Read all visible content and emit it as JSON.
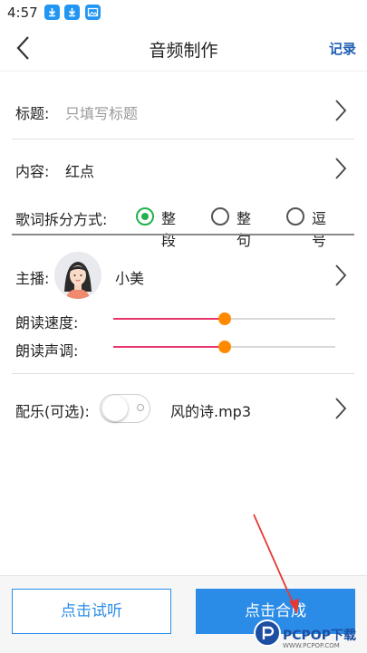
{
  "status_bar": {
    "time": "4:57"
  },
  "nav": {
    "title": "音频制作",
    "right_label": "记录"
  },
  "title_row": {
    "label": "标题:",
    "placeholder": "只填写标题"
  },
  "content_row": {
    "label": "内容:",
    "value": "红点"
  },
  "lyrics_split": {
    "label": "歌词拆分方式:",
    "options": [
      {
        "label": "整段",
        "selected": true
      },
      {
        "label": "整句",
        "selected": false
      },
      {
        "label": "逗号",
        "selected": false
      }
    ]
  },
  "anchor": {
    "label": "主播:",
    "name": "小美"
  },
  "reading_speed": {
    "label": "朗读速度:",
    "level": 0.5
  },
  "reading_pitch": {
    "label": "朗读声调:",
    "level": 0.5
  },
  "music": {
    "label": "配乐(可选):",
    "enabled": false,
    "file": "风的诗.mp3"
  },
  "actions": {
    "listen_label": "点击试听",
    "compose_label": "点击合成"
  },
  "watermark": {
    "text": "PCPOP下载",
    "sub": "WWW.PCPOP.COM"
  },
  "colors": {
    "accent": "#2b8ce8",
    "radio_selected": "#22b14c",
    "slider_fill": "#e8336b",
    "slider_thumb": "#ff8a00",
    "arrow": "#e53935"
  }
}
